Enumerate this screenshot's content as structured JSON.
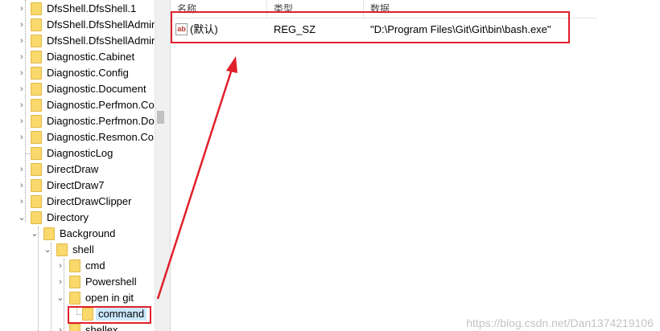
{
  "tree": {
    "items": [
      {
        "label": "DfsShell.DfsShell.1",
        "expander": ">"
      },
      {
        "label": "DfsShell.DfsShellAdmin",
        "expander": ">"
      },
      {
        "label": "DfsShell.DfsShellAdmin",
        "expander": ">"
      },
      {
        "label": "Diagnostic.Cabinet",
        "expander": ">"
      },
      {
        "label": "Diagnostic.Config",
        "expander": ">"
      },
      {
        "label": "Diagnostic.Document",
        "expander": ">"
      },
      {
        "label": "Diagnostic.Perfmon.Co",
        "expander": ">"
      },
      {
        "label": "Diagnostic.Perfmon.Do",
        "expander": ">"
      },
      {
        "label": "Diagnostic.Resmon.Co",
        "expander": ">"
      },
      {
        "label": "DiagnosticLog",
        "expander": ""
      },
      {
        "label": "DirectDraw",
        "expander": ">"
      },
      {
        "label": "DirectDraw7",
        "expander": ">"
      },
      {
        "label": "DirectDrawClipper",
        "expander": ">"
      },
      {
        "label": "Directory",
        "expander": "v"
      },
      {
        "label": "Background",
        "expander": "v"
      },
      {
        "label": "shell",
        "expander": "v"
      },
      {
        "label": "cmd",
        "expander": ">"
      },
      {
        "label": "Powershell",
        "expander": ">"
      },
      {
        "label": "open in git",
        "expander": "v"
      },
      {
        "label": "command",
        "expander": ""
      },
      {
        "label": "shellex",
        "expander": ">"
      }
    ]
  },
  "values": {
    "columns": {
      "name": "名称",
      "type": "类型",
      "data": "数据"
    },
    "rows": [
      {
        "icon": "string-value-icon",
        "icon_text": "ab",
        "name": "(默认)",
        "type": "REG_SZ",
        "data": "\"D:\\Program Files\\Git\\Git\\bin\\bash.exe\""
      }
    ]
  },
  "watermark": "https://blog.csdn.net/Dan1374219106",
  "colors": {
    "annotation": "#e0202a",
    "folder": "#f9d86c",
    "selected": "#cce8ff"
  }
}
